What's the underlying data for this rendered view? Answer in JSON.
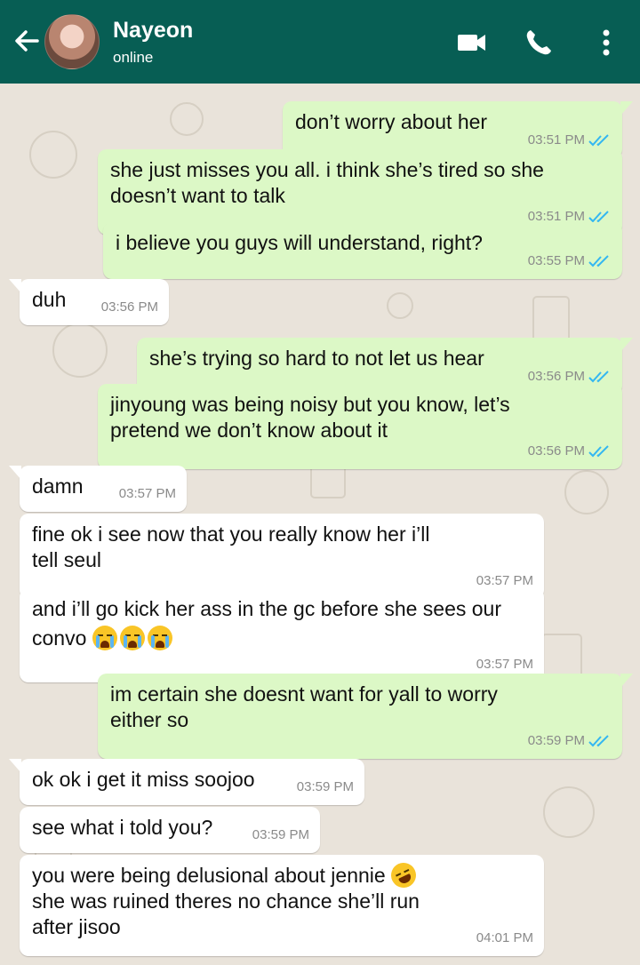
{
  "header": {
    "contact_name": "Nayeon",
    "status": "online",
    "icons": [
      "back-arrow-icon",
      "avatar",
      "video-call-icon",
      "phone-call-icon",
      "more-options-icon"
    ],
    "background": "#075e54"
  },
  "chat": {
    "background": "#e9e3da",
    "outgoing_color": "#dcf8c6",
    "incoming_color": "#ffffff",
    "tick_color": "#34b7f1",
    "messages": [
      {
        "dir": "out",
        "lines": [
          "don’t worry about her"
        ],
        "time": "03:51 PM",
        "read": true
      },
      {
        "dir": "out",
        "lines": [
          "she just misses you all. i think she’s tired so she",
          "doesn’t want to talk"
        ],
        "time": "03:51 PM",
        "read": true
      },
      {
        "dir": "out",
        "lines": [
          "i believe you guys will understand, right?"
        ],
        "time": "03:55 PM",
        "read": true
      },
      {
        "dir": "in",
        "lines": [
          "duh"
        ],
        "time": "03:56 PM"
      },
      {
        "dir": "out",
        "lines": [
          "she’s trying so hard to not let us hear"
        ],
        "time": "03:56 PM",
        "read": true
      },
      {
        "dir": "out",
        "lines": [
          "jinyoung was being noisy but you know, let’s",
          "pretend we don’t know about it"
        ],
        "time": "03:56 PM",
        "read": true
      },
      {
        "dir": "in",
        "lines": [
          "damn"
        ],
        "time": "03:57 PM"
      },
      {
        "dir": "in",
        "lines": [
          "fine ok i see now that you really know her i’ll",
          "tell seul"
        ],
        "time": "03:57 PM"
      },
      {
        "dir": "in",
        "lines": [
          "and i’ll go kick her ass in the gc before she sees our",
          "convo"
        ],
        "emoji_after_last_line": [
          "loudly-crying-face",
          "loudly-crying-face",
          "loudly-crying-face"
        ],
        "time": "03:57 PM"
      },
      {
        "dir": "out",
        "lines": [
          "im certain she doesnt want for yall to worry",
          "either so"
        ],
        "time": "03:59 PM",
        "read": true
      },
      {
        "dir": "in",
        "lines": [
          "ok ok i get it miss soojoo"
        ],
        "time": "03:59 PM"
      },
      {
        "dir": "in",
        "lines": [
          "see what i told you?"
        ],
        "time": "03:59 PM"
      },
      {
        "dir": "in",
        "lines": [
          "you were being delusional about jennie",
          "she was ruined theres no chance she’ll run",
          "after jisoo"
        ],
        "emoji_after_first_line": [
          "rolling-on-the-floor-laughing"
        ],
        "time": "04:01 PM"
      }
    ]
  }
}
